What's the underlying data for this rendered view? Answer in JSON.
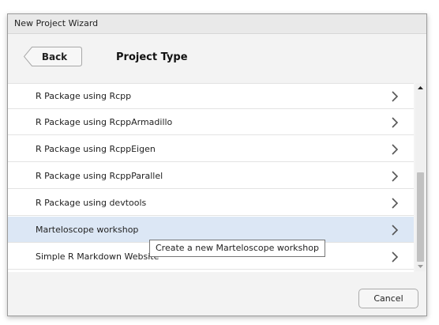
{
  "window": {
    "title": "New Project Wizard"
  },
  "header": {
    "back_label": "Back",
    "title": "Project Type"
  },
  "list": {
    "items": [
      {
        "label": "R Package using Rcpp",
        "icon": "chevron-right-icon"
      },
      {
        "label": "R Package using RcppArmadillo",
        "icon": "chevron-right-icon"
      },
      {
        "label": "R Package using RcppEigen",
        "icon": "chevron-right-icon"
      },
      {
        "label": "R Package using RcppParallel",
        "icon": "chevron-right-icon"
      },
      {
        "label": "R Package using devtools",
        "icon": "chevron-right-icon"
      },
      {
        "label": "Marteloscope workshop",
        "icon": "chevron-right-icon",
        "selected": true
      },
      {
        "label": "Simple R Markdown Website",
        "icon": "chevron-right-icon"
      }
    ]
  },
  "tooltip": {
    "text": "Create a new Marteloscope workshop"
  },
  "footer": {
    "cancel_label": "Cancel"
  },
  "colors": {
    "selected_row": "#dce7f5",
    "window_bg": "#f3f3f3"
  }
}
